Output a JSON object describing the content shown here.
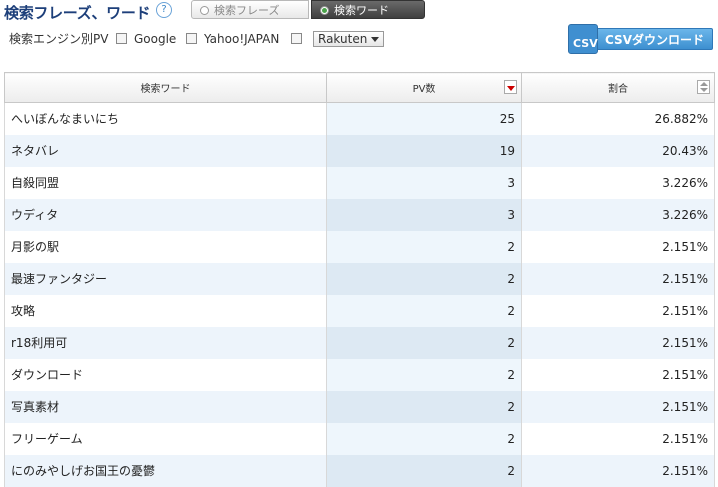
{
  "header": {
    "title": "検索フレーズ、ワード",
    "help_icon": "?",
    "tabs": [
      {
        "label": "検索フレーズ",
        "selected": false
      },
      {
        "label": "検索ワード",
        "selected": true
      }
    ]
  },
  "filters": {
    "label": "検索エンジン別PV",
    "engines": [
      {
        "label": "Google",
        "checked": false
      },
      {
        "label": "Yahoo!JAPAN",
        "checked": false
      },
      {
        "label": "",
        "checked": false
      }
    ],
    "select_value": "Rakuten"
  },
  "csv_button": {
    "icon_text": "CSV",
    "label": "CSVダウンロード",
    "color": "#3d8fd0"
  },
  "table": {
    "headers": [
      "検索ワード",
      "PV数",
      "割合"
    ],
    "rows": [
      {
        "word": "へいぼんなまいにち",
        "pv": "25",
        "ratio": "26.882%"
      },
      {
        "word": "ネタバレ",
        "pv": "19",
        "ratio": "20.43%"
      },
      {
        "word": "自殺同盟",
        "pv": "3",
        "ratio": "3.226%"
      },
      {
        "word": "ウディタ",
        "pv": "3",
        "ratio": "3.226%"
      },
      {
        "word": "月影の駅",
        "pv": "2",
        "ratio": "2.151%"
      },
      {
        "word": "最速ファンタジー",
        "pv": "2",
        "ratio": "2.151%"
      },
      {
        "word": "攻略",
        "pv": "2",
        "ratio": "2.151%"
      },
      {
        "word": "r18利用可",
        "pv": "2",
        "ratio": "2.151%"
      },
      {
        "word": "ダウンロード",
        "pv": "2",
        "ratio": "2.151%"
      },
      {
        "word": "写真素材",
        "pv": "2",
        "ratio": "2.151%"
      },
      {
        "word": "フリーゲーム",
        "pv": "2",
        "ratio": "2.151%"
      },
      {
        "word": "にのみやしげお国王の憂鬱",
        "pv": "2",
        "ratio": "2.151%"
      }
    ]
  }
}
